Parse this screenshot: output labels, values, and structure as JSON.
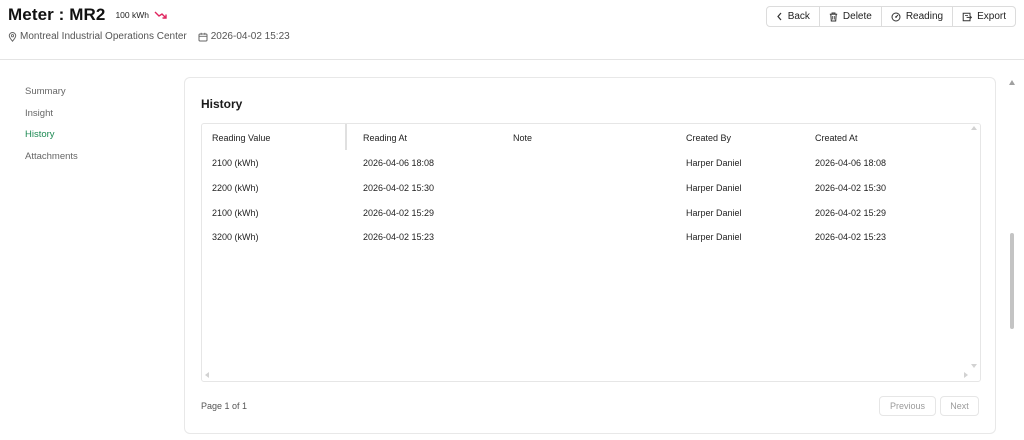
{
  "header": {
    "title": "Meter : MR2",
    "badge": "100 kWh",
    "trend_icon": "trend-down-icon",
    "trend_color": "#e0245e",
    "location": "Montreal Industrial Operations Center",
    "location_icon": "location-pin-icon",
    "datetime": "2026-04-02 15:23",
    "calendar_icon": "calendar-icon"
  },
  "toolbar": {
    "back_label": "Back",
    "delete_label": "Delete",
    "reading_label": "Reading",
    "export_label": "Export"
  },
  "nav": {
    "items": [
      {
        "label": "Summary"
      },
      {
        "label": "Insight"
      },
      {
        "label": "History"
      },
      {
        "label": "Attachments"
      }
    ],
    "active": "History",
    "active_color": "#1d8a53"
  },
  "history": {
    "title": "History",
    "columns": [
      "Reading Value",
      "Reading At",
      "Note",
      "Created By",
      "Created At"
    ],
    "rows": [
      {
        "value": "2100 (kWh)",
        "reading_at": "2026-04-06 18:08",
        "note": "",
        "created_by": "Harper Daniel",
        "created_at": "2026-04-06 18:08"
      },
      {
        "value": "2200 (kWh)",
        "reading_at": "2026-04-02 15:30",
        "note": "",
        "created_by": "Harper Daniel",
        "created_at": "2026-04-02 15:30"
      },
      {
        "value": "2100 (kWh)",
        "reading_at": "2026-04-02 15:29",
        "note": "",
        "created_by": "Harper Daniel",
        "created_at": "2026-04-02 15:29"
      },
      {
        "value": "3200 (kWh)",
        "reading_at": "2026-04-02 15:23",
        "note": "",
        "created_by": "Harper Daniel",
        "created_at": "2026-04-02 15:23"
      }
    ]
  },
  "pagination": {
    "info": "Page 1 of 1",
    "previous_label": "Previous",
    "next_label": "Next"
  }
}
